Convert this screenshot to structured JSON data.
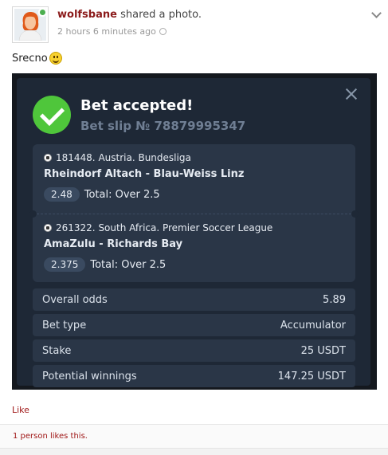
{
  "post": {
    "author": "wolfsbane",
    "action": "shared a photo.",
    "time": "2 hours 6 minutes ago",
    "caption": "Srecno"
  },
  "bet": {
    "title": "Bet accepted!",
    "slip": "Bet slip № 78879995347",
    "events": [
      {
        "league": "181448. Austria. Bundesliga",
        "match": "Rheindorf Altach - Blau-Weiss Linz",
        "odd": "2.48",
        "market": "Total: Over 2.5"
      },
      {
        "league": "261322. South Africa. Premier Soccer League",
        "match": "AmaZulu - Richards Bay",
        "odd": "2.375",
        "market": "Total: Over 2.5"
      }
    ],
    "summary": [
      {
        "label": "Overall odds",
        "value": "5.89"
      },
      {
        "label": "Bet type",
        "value": "Accumulator"
      },
      {
        "label": "Stake",
        "value": "25 USDT"
      },
      {
        "label": "Potential winnings",
        "value": "147.25 USDT"
      }
    ]
  },
  "actions": {
    "like": "Like",
    "likes_summary": "1 person likes this."
  },
  "colors": {
    "author": "#8b1a1a",
    "card": "#1e2836",
    "panel": "#2a3647",
    "success": "#4fc63b",
    "link": "#a01818"
  },
  "icons": [
    "avatar",
    "online-status-icon",
    "globe-icon",
    "chevron-down-icon",
    "smiley-icon",
    "close-icon",
    "checkmark-icon",
    "soccer-ball-icon"
  ]
}
